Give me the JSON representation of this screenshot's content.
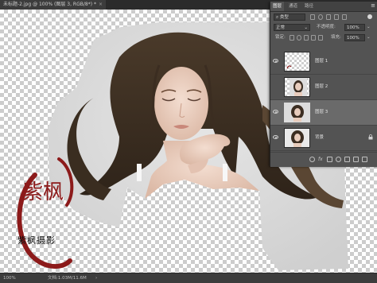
{
  "document_tab": {
    "title": "未标题-2.jpg @ 100% (图层 3, RGB/8*) *",
    "close": "×"
  },
  "status": {
    "zoom": "100%",
    "doc_info": "文档:1.03M/11.6M",
    "arrow": "›"
  },
  "watermark": {
    "text": "紫枫摄影",
    "logo_text": "紫枫"
  },
  "panel": {
    "tabs": [
      "图层",
      "通道",
      "路径"
    ],
    "menu_icon": "hamburger-menu-icon",
    "kind_label": "类型",
    "blend_mode": "正常",
    "opacity_label": "不透明度:",
    "opacity_value": "100%",
    "lock_label": "锁定:",
    "fill_label": "填充:",
    "fill_value": "100%",
    "layers": [
      {
        "name": "图层 1",
        "visible": true,
        "selected": false,
        "thumb": "transparent"
      },
      {
        "name": "图层 2",
        "visible": false,
        "selected": false,
        "thumb": "portrait"
      },
      {
        "name": "图层 3",
        "visible": true,
        "selected": true,
        "thumb": "portrait"
      },
      {
        "name": "背景",
        "visible": true,
        "selected": false,
        "thumb": "portrait",
        "locked": true
      }
    ]
  },
  "colors": {
    "annotation_arrow": "#e23b2e",
    "selected_layer": "#6a6a6a",
    "seal_red": "#8c1a1a"
  }
}
